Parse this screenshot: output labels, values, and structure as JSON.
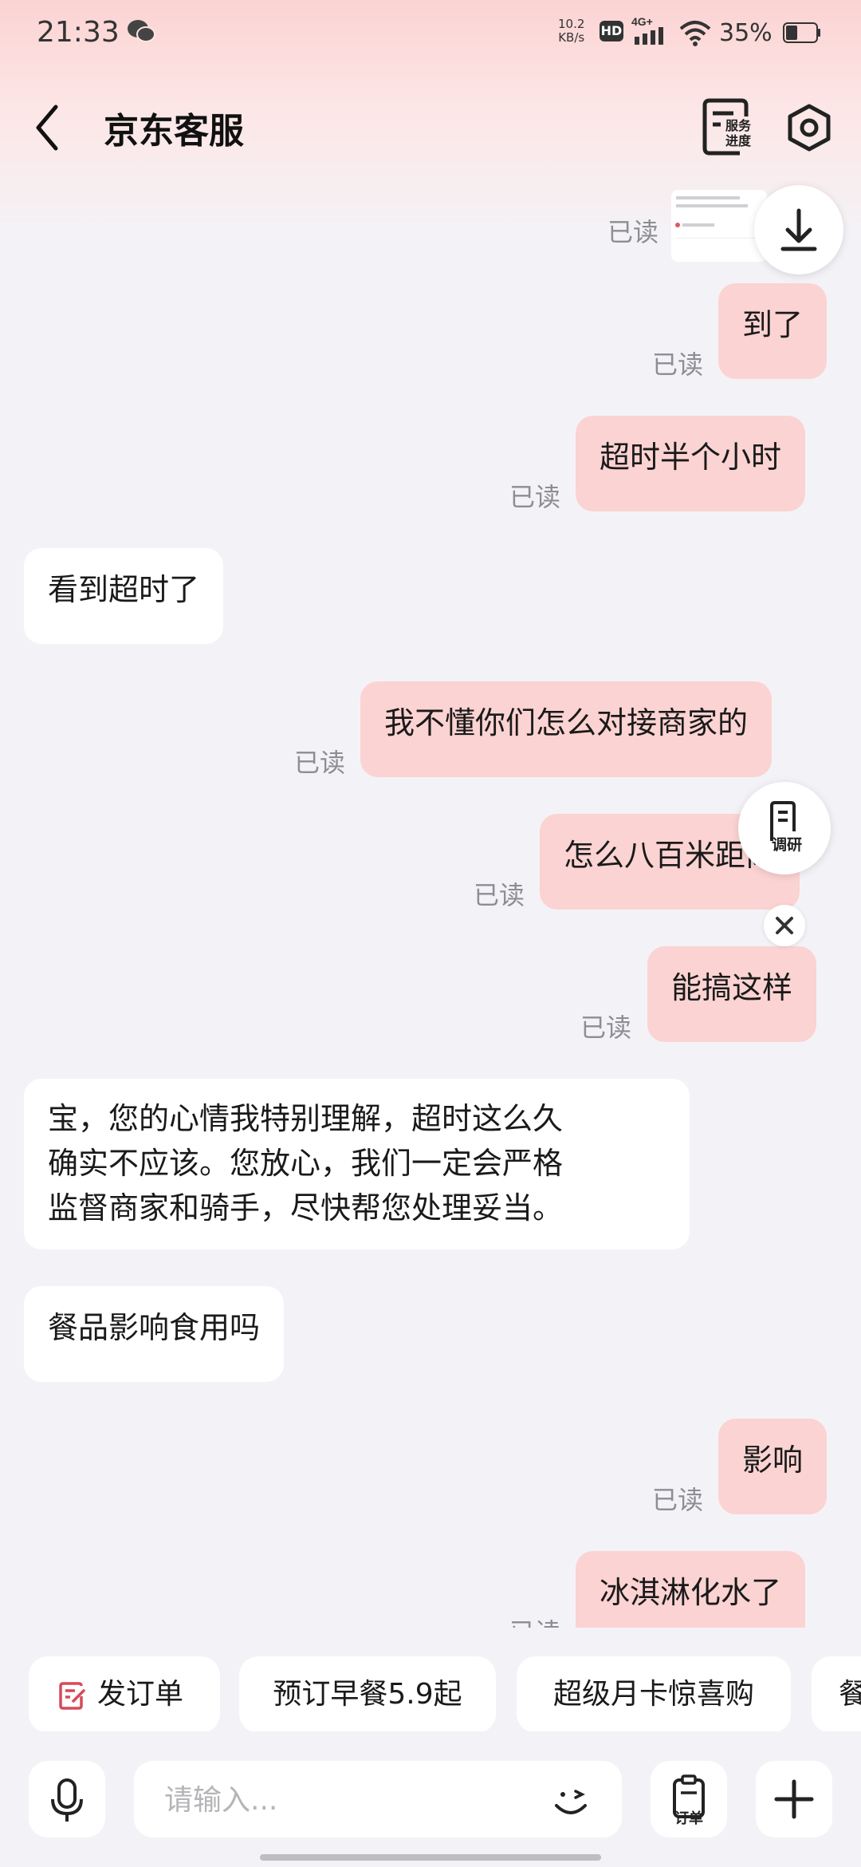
{
  "status_bar": {
    "time": "21:33",
    "net_speed_value": "10.2",
    "net_speed_unit": "KB/s",
    "hd": "HD",
    "network": "4G+",
    "battery": "35%"
  },
  "header": {
    "title": "京东客服",
    "service_progress_label": "服务进度"
  },
  "messages": [
    {
      "side": "out",
      "text": "到了",
      "status": "已读"
    },
    {
      "side": "out",
      "text": "超时半个小时",
      "status": "已读"
    },
    {
      "side": "in",
      "text": "看到超时了"
    },
    {
      "side": "out",
      "text": "我不懂你们怎么对接商家的",
      "status": "已读"
    },
    {
      "side": "out",
      "text": "怎么八百米距离",
      "status": "已读"
    },
    {
      "side": "out",
      "text": "能搞这样",
      "status": "已读"
    },
    {
      "side": "in",
      "text": "宝，您的心情我特别理解，超时这么久\n确实不应该。您放心，我们一定会严格\n监督商家和骑手，尽快帮您处理妥当。"
    },
    {
      "side": "in",
      "text": "餐品影响食用吗"
    },
    {
      "side": "out",
      "text": "影响",
      "status": "已读"
    },
    {
      "side": "out",
      "text": "冰淇淋化水了",
      "status": "已读"
    }
  ],
  "top_partial_status": "已读",
  "floating": {
    "survey_label": "调研"
  },
  "quick_chips": [
    "发订单",
    "预订早餐5.9起",
    "超级月卡惊喜购",
    "餐"
  ],
  "input": {
    "placeholder": "请输入...",
    "order_label": "订单"
  },
  "colors": {
    "outgoing_bubble": "#fbd3d2",
    "incoming_bubble": "#ffffff",
    "accent": "#d64a5a"
  }
}
